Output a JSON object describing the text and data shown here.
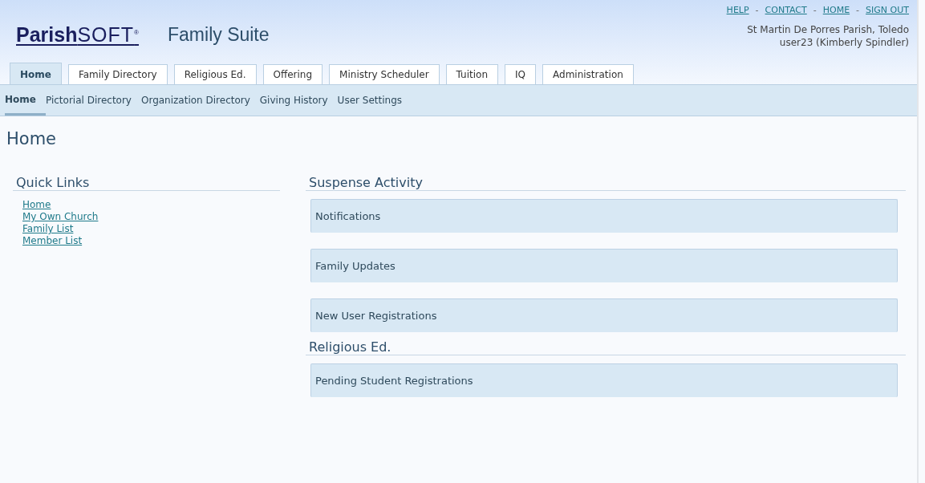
{
  "logo": {
    "name": "Parish",
    "suffix": "SOFT",
    "mark": "®"
  },
  "app_title": "Family Suite",
  "top_links": [
    "HELP",
    "CONTACT",
    "HOME",
    "SIGN OUT"
  ],
  "top_link_separator": "-",
  "account": {
    "parish": "St Martin De Porres Parish, Toledo",
    "user": "user23 (Kimberly Spindler)"
  },
  "tabs": [
    {
      "label": "Home",
      "selected": true
    },
    {
      "label": "Family Directory",
      "selected": false
    },
    {
      "label": "Religious Ed.",
      "selected": false
    },
    {
      "label": "Offering",
      "selected": false
    },
    {
      "label": "Ministry Scheduler",
      "selected": false
    },
    {
      "label": "Tuition",
      "selected": false
    },
    {
      "label": "IQ",
      "selected": false
    },
    {
      "label": "Administration",
      "selected": false
    }
  ],
  "subnav": [
    {
      "label": "Home",
      "selected": true
    },
    {
      "label": "Pictorial Directory",
      "selected": false
    },
    {
      "label": "Organization Directory",
      "selected": false
    },
    {
      "label": "Giving History",
      "selected": false
    },
    {
      "label": "User Settings",
      "selected": false
    }
  ],
  "page_title": "Home",
  "quick_links": {
    "title": "Quick Links",
    "items": [
      "Home",
      "My Own Church",
      "Family List",
      "Member List"
    ]
  },
  "sections": [
    {
      "title": "Suspense Activity",
      "panels": [
        "Notifications",
        "Family Updates",
        "New User Registrations"
      ]
    },
    {
      "title": "Religious Ed.",
      "panels": [
        "Pending Student Registrations"
      ]
    }
  ]
}
